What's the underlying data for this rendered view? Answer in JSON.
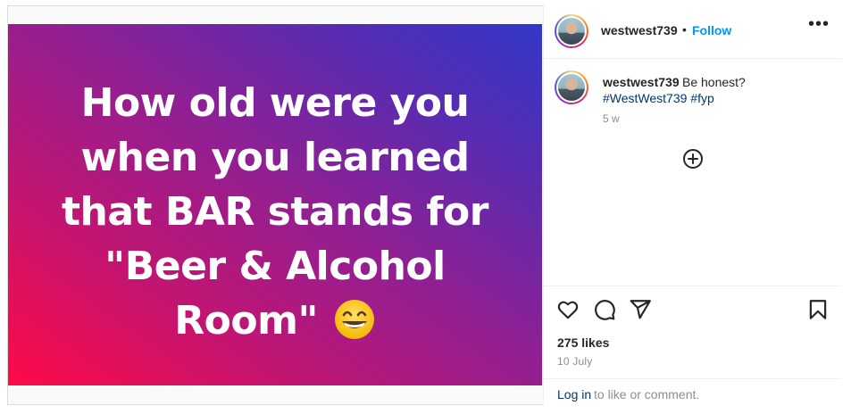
{
  "post": {
    "image_text_lines": [
      "How old were you",
      "when you learned",
      "that BAR stands for",
      "\"Beer & Alcohol",
      "Room\""
    ],
    "image_emoji": "grinning-face-emoji"
  },
  "header": {
    "username": "westwest739",
    "separator": "•",
    "follow_label": "Follow",
    "more_label": "•••"
  },
  "caption": {
    "username": "westwest739",
    "text": "Be honest?",
    "hashtags": "#WestWest739 #fyp",
    "time_ago": "5 w"
  },
  "stats": {
    "likes": "275 likes",
    "date": "10 July"
  },
  "footer": {
    "login_label": "Log in",
    "rest_text": "to like or comment."
  },
  "icons": [
    "heart-icon",
    "comment-icon",
    "share-icon",
    "bookmark-icon",
    "add-circle-icon",
    "more-icon"
  ]
}
